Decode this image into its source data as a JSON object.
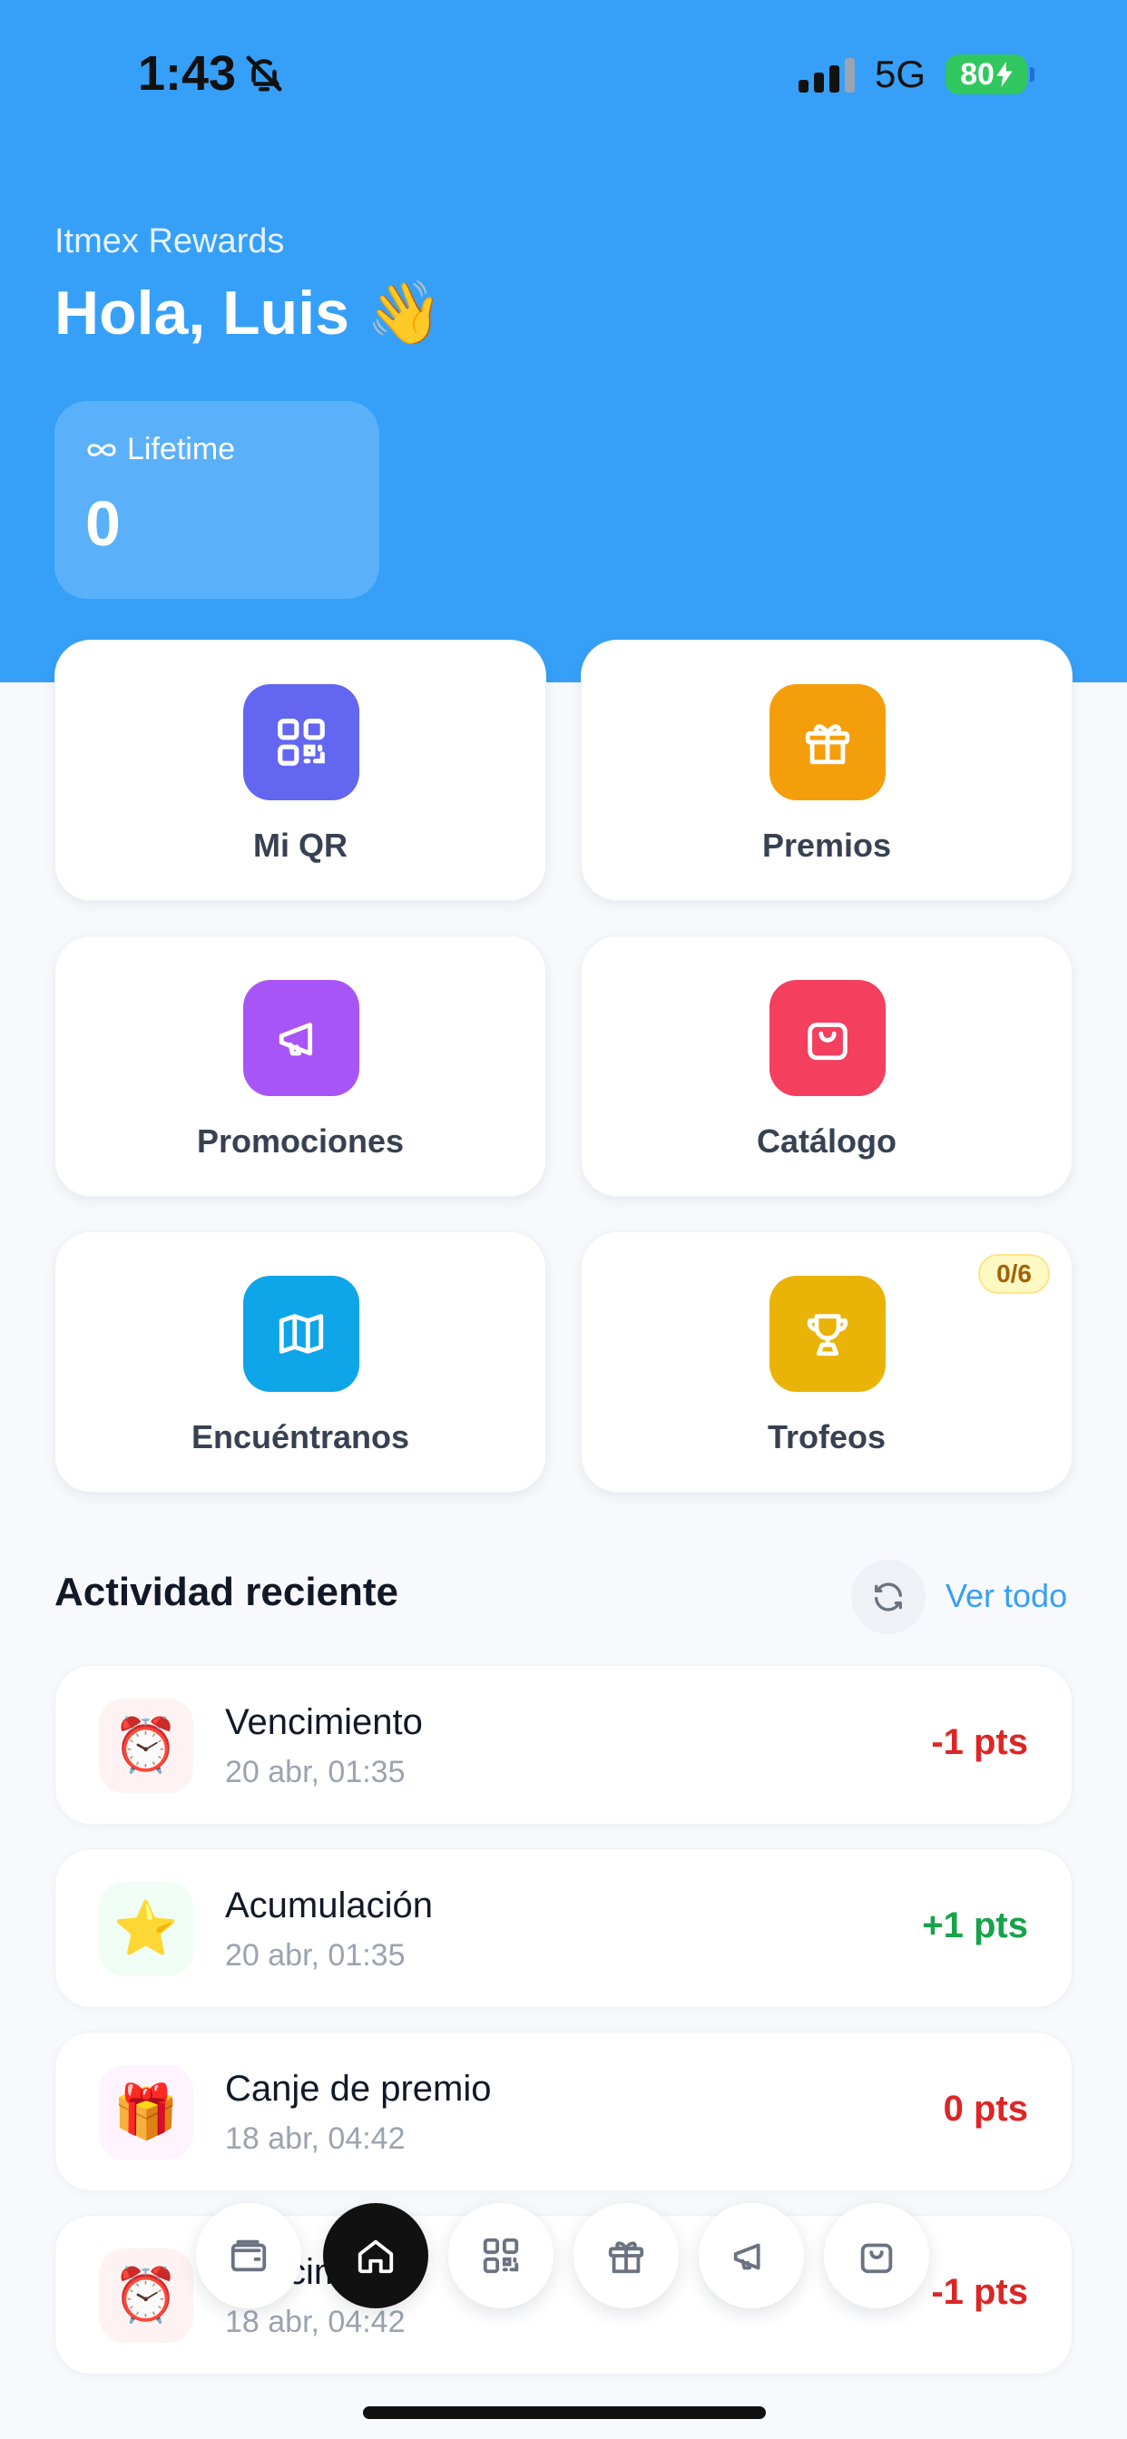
{
  "status_bar": {
    "time": "1:43",
    "network": "5G",
    "battery": "80"
  },
  "header": {
    "app_name": "Itmex Rewards",
    "greeting": "Hola, Luis 👋"
  },
  "lifetime": {
    "label": "Lifetime",
    "value": "0"
  },
  "tiles": [
    {
      "label": "Mi QR",
      "icon": "qr-code-icon",
      "color": "#6366f1"
    },
    {
      "label": "Premios",
      "icon": "gift-icon",
      "color": "#f59e0b"
    },
    {
      "label": "Promociones",
      "icon": "megaphone-icon",
      "color": "#a855f7"
    },
    {
      "label": "Catálogo",
      "icon": "shopping-bag-icon",
      "color": "#f43f5e"
    },
    {
      "label": "Encuéntranos",
      "icon": "map-icon",
      "color": "#0ea5e9"
    },
    {
      "label": "Trofeos",
      "icon": "trophy-icon",
      "color": "#eab308",
      "badge": "0/6"
    }
  ],
  "activity": {
    "title": "Actividad reciente",
    "see_all": "Ver todo",
    "items": [
      {
        "title": "Vencimiento",
        "date": "20 abr, 01:35",
        "points": "-1 pts",
        "emoji": "⏰",
        "color": "#dc2626"
      },
      {
        "title": "Acumulación",
        "date": "20 abr, 01:35",
        "points": "+1 pts",
        "emoji": "⭐",
        "color": "#16a34a"
      },
      {
        "title": "Canje de premio",
        "date": "18 abr, 04:42",
        "points": "0 pts",
        "emoji": "🎁",
        "color": "#dc2626"
      },
      {
        "title": "Vencimiento",
        "date": "18 abr, 04:42",
        "points": "-1 pts",
        "emoji": "⏰",
        "color": "#dc2626"
      }
    ]
  },
  "bottom_nav": [
    "wallet-icon",
    "home-icon",
    "qr-code-icon",
    "gift-icon",
    "megaphone-icon",
    "shopping-bag-icon"
  ]
}
